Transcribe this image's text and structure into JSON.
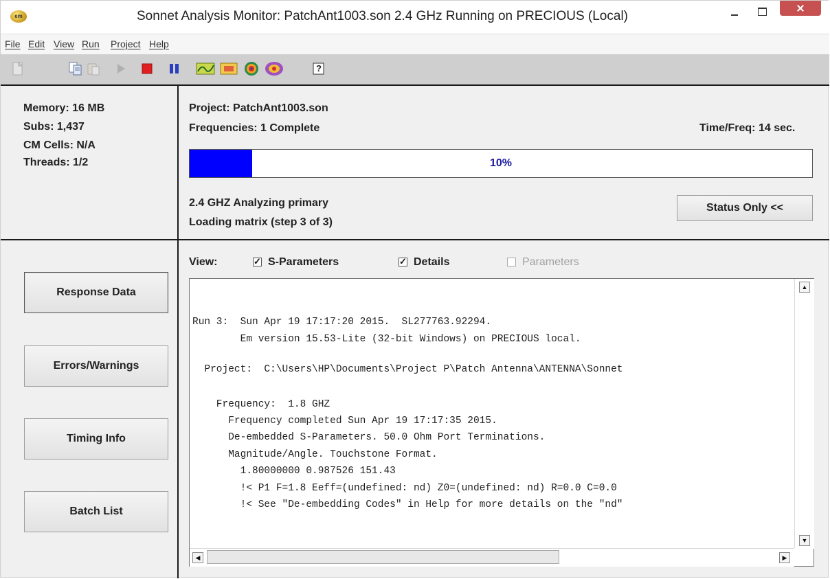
{
  "window": {
    "title": "Sonnet Analysis Monitor: PatchAnt1003.son  2.4 GHz Running on PRECIOUS (Local)",
    "app_icon": "sonnet-em-icon"
  },
  "menu": [
    "File",
    "Edit",
    "View",
    "Run",
    "Project",
    "Help"
  ],
  "toolbar": {
    "icons": [
      "new-icon",
      "copy-icon",
      "paste-icon",
      "play-icon",
      "stop-icon",
      "pause-icon",
      "response-viewer-icon",
      "current-density-icon",
      "far-field-icon",
      "antenna-pattern-icon",
      "help-icon"
    ],
    "help_glyph": "?"
  },
  "stats": {
    "memory": "Memory: 16 MB",
    "subs": "Subs: 1,437",
    "cm_cells": "CM Cells: N/A",
    "threads": "Threads: 1/2"
  },
  "project": {
    "name": "Project:  PatchAnt1003.son",
    "frequencies": "Frequencies:  1 Complete",
    "time_freq": "Time/Freq:  14 sec.",
    "progress_label": "10%",
    "progress_value": 0.1,
    "status_line1": "2.4 GHZ Analyzing primary",
    "status_line2": "Loading matrix (step 3 of 3)",
    "status_button": "Status Only <<"
  },
  "nav": {
    "response_data": "Response Data",
    "errors_warnings": "Errors/Warnings",
    "timing_info": "Timing Info",
    "batch_list": "Batch List"
  },
  "view": {
    "label": "View:",
    "s_parameters": "S-Parameters",
    "details": "Details",
    "parameters": "Parameters"
  },
  "log": [
    "Run 3:  Sun Apr 19 17:17:20 2015.  SL277763.92294.",
    "        Em version 15.53-Lite (32-bit Windows) on PRECIOUS local.",
    "  Project:  C:\\Users\\HP\\Documents\\Project P\\Patch Antenna\\ANTENNA\\Sonnet",
    "    Frequency:  1.8 GHZ",
    "      Frequency completed Sun Apr 19 17:17:35 2015.",
    "      De-embedded S-Parameters. 50.0 Ohm Port Terminations.",
    "      Magnitude/Angle. Touchstone Format.",
    "        1.80000000 0.987526 151.43",
    "        !< P1 F=1.8 Eeff=(undefined: nd) Z0=(undefined: nd) R=0.0 C=0.0",
    "        !< See \"De-embedding Codes\" in Help for more details on the \"nd\""
  ],
  "colors": {
    "progress_fill": "#0000ff",
    "stop": "#e02020",
    "pause": "#2a3fbf",
    "close": "#c75050"
  }
}
